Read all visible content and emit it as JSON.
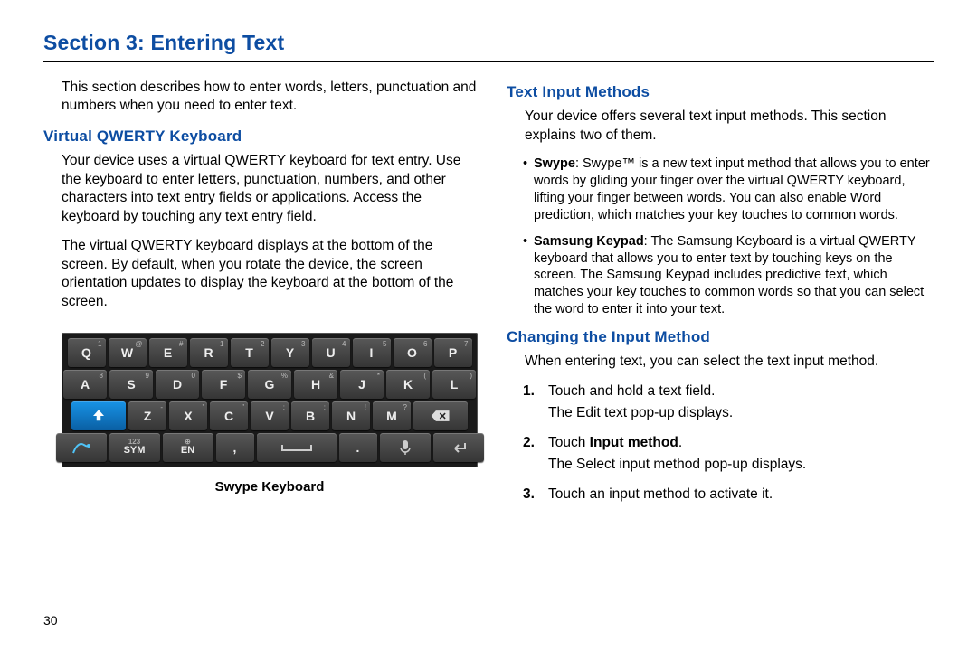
{
  "page_number": "30",
  "section_title": "Section 3: Entering Text",
  "left": {
    "intro": "This section describes how to enter words, letters, punctuation and numbers when you need to enter text.",
    "h_qwerty": "Virtual QWERTY Keyboard",
    "p1": "Your device uses a virtual QWERTY keyboard for text entry. Use the keyboard to enter letters, punctuation, numbers, and other characters into text entry fields or applications. Access the keyboard by touching any text entry field.",
    "p2": "The virtual QWERTY keyboard displays at the bottom of the screen. By default, when you rotate the device, the screen orientation updates to display the keyboard at the bottom of the screen.",
    "kbd_caption": "Swype Keyboard",
    "keyboard": {
      "row1": [
        {
          "label": "Q",
          "sup": "1"
        },
        {
          "label": "W",
          "sup": "@"
        },
        {
          "label": "E",
          "sup": "#"
        },
        {
          "label": "R",
          "sup": "1"
        },
        {
          "label": "T",
          "sup": "2"
        },
        {
          "label": "Y",
          "sup": "3"
        },
        {
          "label": "U",
          "sup": "4"
        },
        {
          "label": "I",
          "sup": "5"
        },
        {
          "label": "O",
          "sup": "6"
        },
        {
          "label": "P",
          "sup": "7"
        }
      ],
      "row2": [
        {
          "label": "A",
          "sup": "8"
        },
        {
          "label": "S",
          "sup": "9"
        },
        {
          "label": "D",
          "sup": "0"
        },
        {
          "label": "F",
          "sup": "$"
        },
        {
          "label": "G",
          "sup": "%"
        },
        {
          "label": "H",
          "sup": "&"
        },
        {
          "label": "J",
          "sup": "*"
        },
        {
          "label": "K",
          "sup": "("
        },
        {
          "label": "L",
          "sup": ")"
        }
      ],
      "row3": [
        {
          "label": "Z",
          "sup": "-"
        },
        {
          "label": "X",
          "sup": "'"
        },
        {
          "label": "C",
          "sup": "\""
        },
        {
          "label": "V",
          "sup": ":"
        },
        {
          "label": "B",
          "sup": ";"
        },
        {
          "label": "N",
          "sup": "!"
        },
        {
          "label": "M",
          "sup": "?"
        }
      ],
      "row4": {
        "sym": "SYM",
        "sub_sym": "123",
        "en": "EN",
        "sub_en": "⊕",
        "comma": ",",
        "period": "."
      }
    }
  },
  "right": {
    "h_methods": "Text Input Methods",
    "p_methods": "Your device offers several text input methods. This section explains two of them.",
    "bullets": [
      {
        "lead": "Swype",
        "text": ": Swype™ is a new text input method that allows you to enter words by gliding your finger over the virtual QWERTY keyboard, lifting your finger between words. You can also enable Word prediction, which matches your key touches to common words."
      },
      {
        "lead": "Samsung Keypad",
        "text": ": The Samsung Keyboard is a virtual QWERTY keyboard that allows you to enter text by touching keys on the screen. The Samsung Keypad includes predictive text, which matches your key touches to common words so that you can select the word to enter it into your text."
      }
    ],
    "h_change": "Changing the Input Method",
    "p_change": "When entering text, you can select the text input method.",
    "steps": [
      {
        "num": "1.",
        "main": "Touch and hold a text field.",
        "sub": "The Edit text pop-up displays."
      },
      {
        "num": "2.",
        "main_pre": "Touch ",
        "main_bold": "Input method",
        "main_post": ".",
        "sub": "The Select input method pop-up displays."
      },
      {
        "num": "3.",
        "main": "Touch an input method to activate it.",
        "sub": ""
      }
    ]
  }
}
